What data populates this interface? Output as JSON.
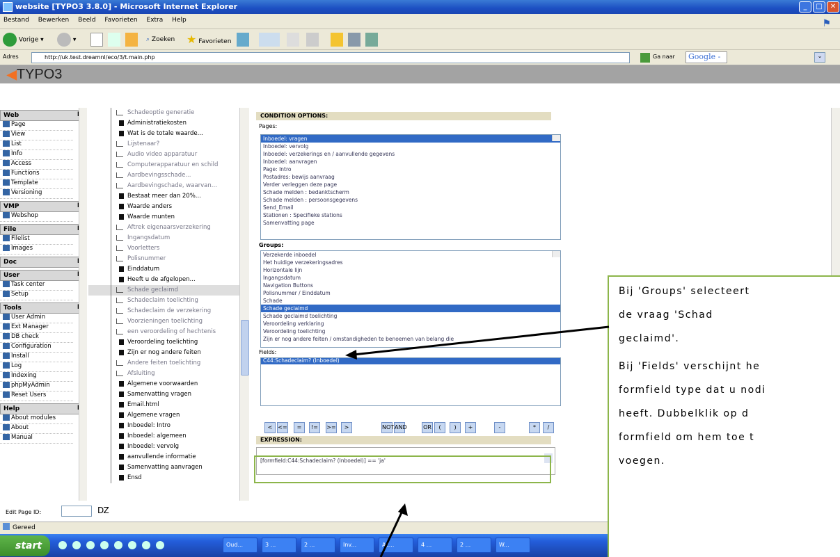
{
  "window": {
    "title": "website [TYPO3 3.8.0] - Microsoft Internet Explorer"
  },
  "menu": [
    "Bestand",
    "Bewerken",
    "Beeld",
    "Favorieten",
    "Extra",
    "Help"
  ],
  "toolbar": {
    "back": "Vorige",
    "search": "Zoeken",
    "favorites": "Favorieten"
  },
  "address": {
    "label": "Adres",
    "url": "http://uk.test.dreamnl/eco/3/t.main.php",
    "go": "Ga naar",
    "google": "Google -"
  },
  "typo3": {
    "logo": "TYPO3"
  },
  "modules": [
    {
      "group": "Web",
      "items": [
        "Page",
        "View",
        "List",
        "Info",
        "Access",
        "Functions",
        "Template",
        "Versioning"
      ]
    },
    {
      "group": "VMP",
      "items": [
        "Webshop"
      ]
    },
    {
      "group": "File",
      "items": [
        "Filelist",
        "Images"
      ]
    },
    {
      "group": "Doc",
      "items": []
    },
    {
      "group": "User",
      "items": [
        "Task center",
        "Setup"
      ]
    },
    {
      "group": "Tools",
      "items": [
        "User Admin",
        "Ext Manager",
        "DB check",
        "Configuration",
        "Install",
        "Log",
        "Indexing",
        "phpMyAdmin",
        "Reset Users"
      ]
    },
    {
      "group": "Help",
      "items": [
        "About modules",
        "About",
        "Manual"
      ]
    }
  ],
  "tree": [
    "Schadeoptie generatie",
    "Administratiekosten",
    "Wat is de totale waarde...",
    "Lijstenaar?",
    "Audio video apparatuur",
    "Computerapparatuur en schild",
    "Aardbevingsschade...",
    "Aardbevingschade, waarvan...",
    "Bestaat meer dan 20%...",
    "Waarde anders",
    "Waarde munten",
    "Aftrek eigenaarsverzekering",
    "Ingangsdatum",
    "Voorletters",
    "Polisnummer",
    "Einddatum",
    "Heeft u de afgelopen...",
    "Schade geclaimd",
    "Schadeclaim toelichting",
    "Schadeclaim de verzekering",
    "Voorzieningen toelichting",
    "een veroordeling of hechtenis",
    "Veroordeling toelichting",
    "Zijn er nog andere feiten",
    "Andere feiten toelichting",
    "Afsluiting",
    "Algemene voorwaarden",
    "Samenvatting vragen",
    "Email.html",
    "Algemene vragen",
    "Inboedel: Intro",
    "Inboedel: algemeen",
    "Inboedel: vervolg",
    "aanvullende informatie",
    "Samenvatting aanvragen",
    "Ensd"
  ],
  "condition": {
    "heading": "CONDITION OPTIONS:",
    "pages_label": "Pages:",
    "pages": [
      "Inboedel: vragen",
      "Inboedel: vervolg",
      "Inboedel: verzekerings en / aanvullende gegevens",
      "Inboedel: aanvragen",
      "Page: Intro",
      "Postadres: bewijs aanvraag",
      "Verder verleggen deze page",
      "Schade melden : bedanktscherm",
      "Schade melden : persoonsgegevens",
      "Send_Email",
      "Stationen : Specifieke stations",
      "Samenvatting page"
    ],
    "groups_label": "Groups:",
    "groups": [
      "Verzekerde inboedel",
      "Het huidige verzekeringsadres",
      "Horizontale lijn",
      "Ingangsdatum",
      "Navigation Buttons",
      "Polisnummer / Einddatum",
      "Schade",
      "Schade geclaimd",
      "Schade geclaimd toelichting",
      "Veroordeling verklaring",
      "Veroordeling toelichting",
      "Zijn er nog andere feiten / omstandigheden te benoemen van belang die"
    ],
    "fields_label": "Fields:",
    "fields": [
      "C44:Schadeclaim? (Inboedel)"
    ],
    "operators": [
      "<",
      "<=",
      "=",
      "!=",
      ">=",
      ">",
      "NOT",
      "AND",
      "OR",
      "(",
      ")",
      "+",
      "-",
      "*",
      "/"
    ],
    "expression_label": "EXPRESSION:",
    "expression": "[formfield:C44:Schadeclaim? (Inboedel)] == 'ja'"
  },
  "bottom": {
    "edit_label": "Edit Page ID:"
  },
  "status": {
    "text": "Gereed"
  },
  "taskbar": {
    "start": "start",
    "tasks": [
      "Oud...",
      "3 ...",
      "2 ...",
      "Inv...",
      "Ac...",
      "4 ...",
      "2 ...",
      "W..."
    ]
  },
  "callout": {
    "lines": [
      "Bij  'Groups'  selecteert",
      "de          vraag          'Schad",
      "geclaimd'.",
      "Bij  'Fields'  verschijnt  he",
      "formfield  type  dat  u  nodi",
      "heeft.  Dubbelklik  op  d",
      "formfield  om  hem  toe  t",
      "voegen."
    ]
  }
}
